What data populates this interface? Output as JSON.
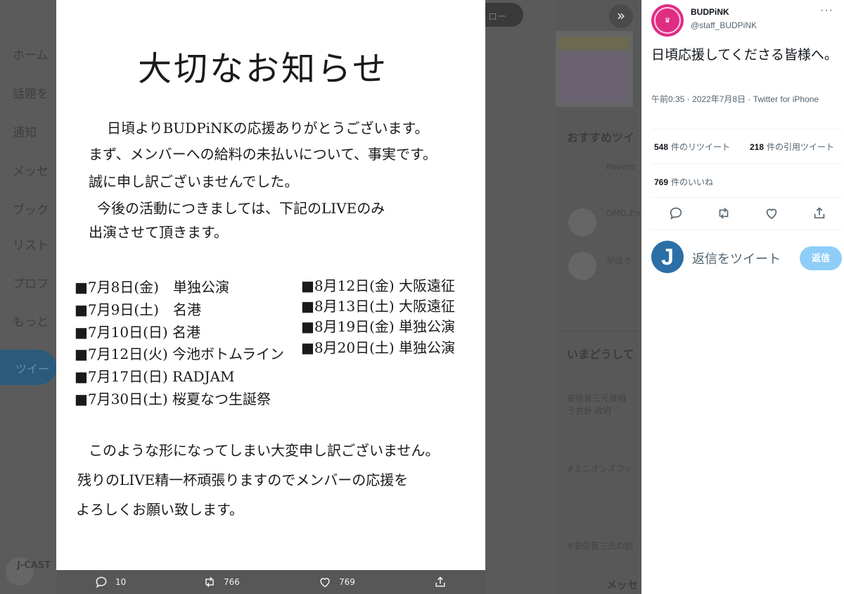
{
  "background": {
    "nav_items": [
      "ホーム",
      "話題を",
      "通知",
      "メッセ",
      "ブック",
      "リスト",
      "プロフ",
      "もっと"
    ],
    "tweet_button": "ツイー",
    "follow_button": "ロー",
    "right_texts": {
      "recommend": "おすすめツイ",
      "now": "いまどうして",
      "trend1": "安倍晋三元首相",
      "trend2": "う方針 政府",
      "trend3": "#ミニオンズフィ",
      "trend4": "#安倍晋三氏の銃",
      "msg": "メッセ",
      "user1": "Revere",
      "user2": "GMG.En",
      "user3": "がほう",
      "jcast": "J-CAST"
    }
  },
  "notice": {
    "title": "大切なお知らせ",
    "lines": [
      "日頃よりBUDPiNKの応援ありがとうございます。",
      "まず、メンバーへの給料の未払いについて、事実です。",
      "誠に申し訳ございませんでした。",
      "今後の活動につきましては、下記のLIVEのみ",
      "出演させて頂きます。"
    ],
    "schedule_left": [
      "■7月8日(金)　単独公演",
      "■7月9日(土)　名港",
      "■7月10日(日) 名港",
      "■7月12日(火) 今池ボトムライン",
      "■7月17日(日) RADJAM",
      "■7月30日(土) 桜夏なつ生誕祭"
    ],
    "schedule_right": [
      "■8月12日(金) 大阪遠征",
      "■8月13日(土) 大阪遠征",
      "■8月19日(金) 単独公演",
      "■8月20日(土) 単独公演"
    ],
    "closing": [
      "このような形になってしまい大変申し訳ございません。",
      "残りのLIVE精一杯頑張りますのでメンバーの応援を",
      "よろしくお願い致します。"
    ]
  },
  "image_actions": {
    "replies": "10",
    "retweets": "766",
    "likes": "769"
  },
  "tweet": {
    "name": "BUDPiNK",
    "handle": "@staff_BUDPiNK",
    "more": "···",
    "body": "日頃応援してくださる皆様へ。",
    "meta": "午前0:35 · 2022年7月8日 · Twitter for iPhone",
    "retweets_count": "548",
    "retweets_label": "件のリツイート",
    "quotes_count": "218",
    "quotes_label": "件の引用ツイート",
    "likes_count": "769",
    "likes_label": "件のいいね",
    "reply_placeholder": "返信をツイート",
    "reply_button": "返信",
    "reply_avatar": "J"
  },
  "colors": {
    "accent": "#1d9bf0",
    "reply_button": "#8ecdf8",
    "avatar_pink": "#e02d84"
  }
}
